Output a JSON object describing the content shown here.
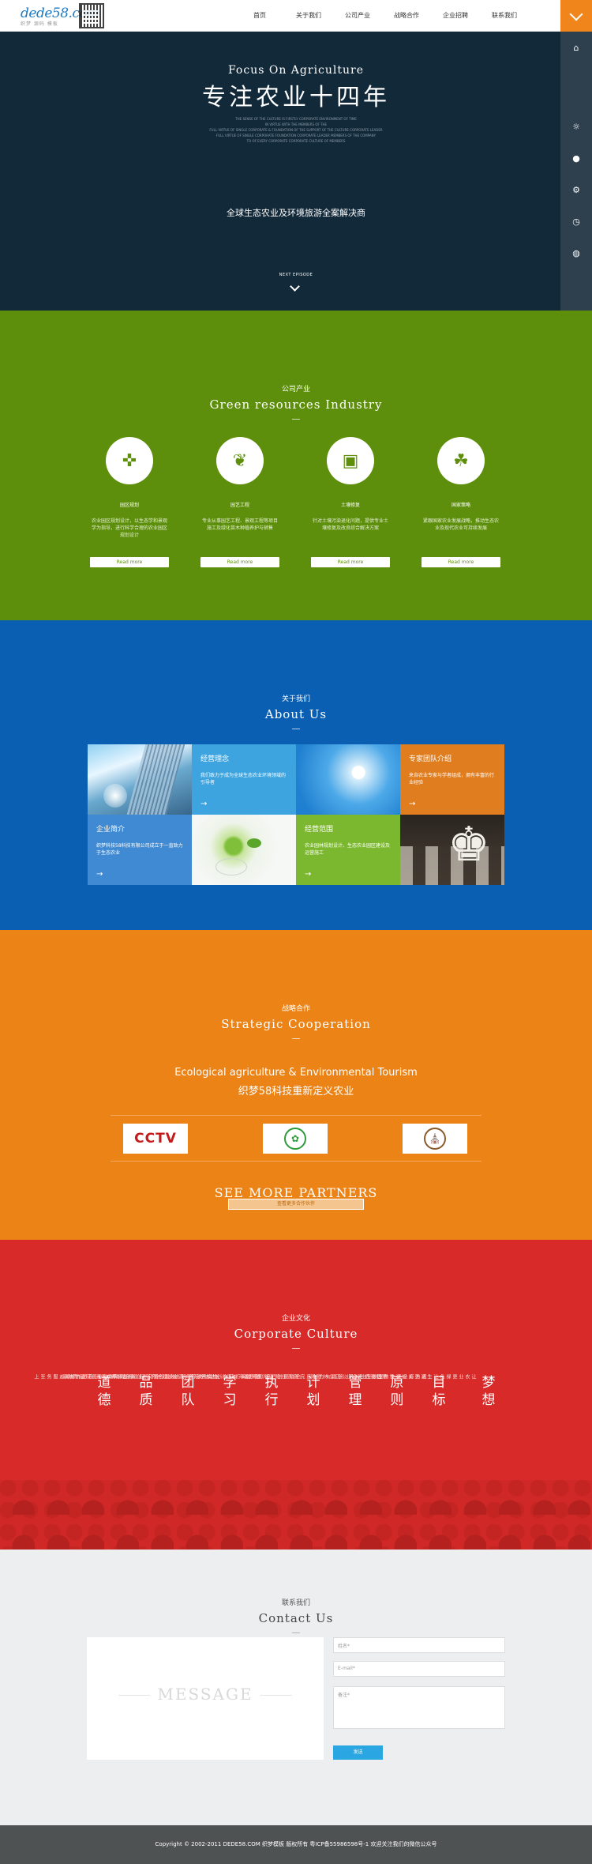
{
  "header": {
    "logo_text": "dede58.com",
    "logo_sub": "织梦 源码 模板",
    "nav": [
      "首页",
      "关于我们",
      "公司产业",
      "战略合作",
      "企业招聘",
      "联系我们"
    ]
  },
  "hero": {
    "en_title": "Focus On Agriculture",
    "cn_title": "专注农业十四年",
    "small_lines": [
      "THE SENSE OF THE CULTURE IS FIRSTLY CORPORATE ENVIRONMENT OF TIME",
      "IN VIRTUE WITH THE MEMBERS OF THE",
      "FULL VIRTUE OF SINGLE CORPORATE & FOUNDATION OF THE SUPPORT OF THE CULTURE CORPORATE LEADER",
      "FULL VIRTUE OF SINGLE CORPORATE FOUNDATION CORPORATE LEADER MEMBERS OF THE COMPANY",
      "TO OF EVERY CORPORATE CORPORATE CULTURE OF MEMBERS"
    ],
    "subtitle": "全球生态农业及环境旅游全案解决商",
    "next_label": "NEXT EPISODE"
  },
  "sidebar": {
    "icons": [
      "home-icon",
      "sun-icon",
      "user-icon",
      "gear-icon",
      "clock-icon",
      "globe-icon"
    ]
  },
  "industry": {
    "cn": "公司产业",
    "en": "Green resources Industry",
    "items": [
      {
        "title": "园区规划",
        "desc": "农业园区规划设计，以生态学和景观学为指导，进行科学合理的农业园区规划设计",
        "btn": "Read more"
      },
      {
        "title": "园艺工程",
        "desc": "专业从事园艺工程、景观工程等项目施工及绿化苗木种植养护与销售",
        "btn": "Read more"
      },
      {
        "title": "土壤修复",
        "desc": "针对土壤污染退化问题，提供专业土壤修复及改良综合解决方案",
        "btn": "Read more"
      },
      {
        "title": "国家策略",
        "desc": "紧跟国家农业发展战略，推动生态农业及现代农业可持续发展",
        "btn": "Read more"
      }
    ]
  },
  "about": {
    "cn": "关于我们",
    "en": "About Us",
    "cells": [
      {
        "title": "经营理念",
        "desc": "我们致力于成为全球生态农业环境领域的引导者"
      },
      {
        "title": "专家团队介绍",
        "desc": "来自农业专家与学者组成，拥有丰富的行业经验"
      },
      {
        "title": "企业简介",
        "desc": "织梦科技58科技有限公司成立于一直致力于生态农业"
      },
      {
        "title": "经营范围",
        "desc": "农业园林规划设计、生态农业园区建设及运营施工"
      }
    ]
  },
  "cooperation": {
    "cn": "战略合作",
    "en": "Strategic Cooperation",
    "line1": "Ecological agriculture & Environmental Tourism",
    "line2": "织梦58科技重新定义农业",
    "logos": [
      "CCTV",
      "农业部",
      "大学"
    ],
    "more": "SEE MORE PARTNERS",
    "more_btn": "查看更多合作伙伴"
  },
  "culture": {
    "cn": "企业文化",
    "en": "Corporate Culture",
    "columns": [
      {
        "big": "道德",
        "text": "正直守信"
      },
      {
        "big": "品质",
        "text": "精益求精 注重细节 品质卓越 服务至上"
      },
      {
        "big": "团队",
        "text": "协同合作 一起成长 凝聚力量 团队协作共赢"
      },
      {
        "big": "学习",
        "text": "持续学习不断进步 成长 不断创新追求卓越"
      },
      {
        "big": "执行",
        "text": "雷厉风行 使命必达 结果导向 高效执行落实"
      },
      {
        "big": "计划",
        "text": "合理规划 严谨思考 做事有序 计划周密完善"
      },
      {
        "big": "管理",
        "text": "管理有方 制度完善 责任明确 沟通协调"
      },
      {
        "big": "原则",
        "text": "原则至上 公平公正 坚持原则"
      },
      {
        "big": "目标",
        "text": "成为行业领先的生态农业企业"
      },
      {
        "big": "梦想",
        "text": "让农业更绿色 让生活更美好 让世界因我们更好"
      }
    ]
  },
  "contact": {
    "cn": "联系我们",
    "en": "Contact Us",
    "message_placeholder": "MESSAGE",
    "name_placeholder": "姓名*",
    "email_placeholder": "E-mail*",
    "note_placeholder": "备注*",
    "send": "发送"
  },
  "footer": {
    "text": "Copyright © 2002-2011 DEDE58.COM 织梦模板 版权所有 粤ICP备55986598号-1    欢迎关注我们的微信公众号"
  }
}
